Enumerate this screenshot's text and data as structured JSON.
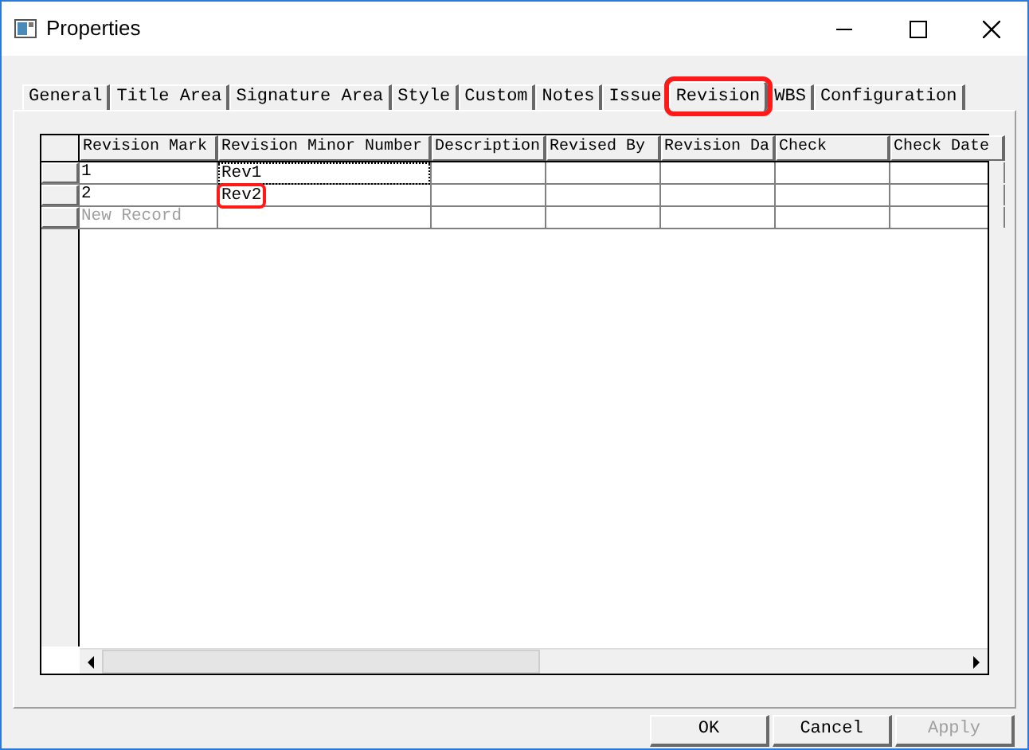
{
  "window": {
    "title": "Properties"
  },
  "tabs": [
    {
      "label": "General",
      "selected": false,
      "highlighted": false
    },
    {
      "label": "Title Area",
      "selected": false,
      "highlighted": false
    },
    {
      "label": "Signature Area",
      "selected": false,
      "highlighted": false
    },
    {
      "label": "Style",
      "selected": false,
      "highlighted": false
    },
    {
      "label": "Custom",
      "selected": false,
      "highlighted": false
    },
    {
      "label": "Notes",
      "selected": false,
      "highlighted": false
    },
    {
      "label": "Issue",
      "selected": false,
      "highlighted": false
    },
    {
      "label": "Revision",
      "selected": true,
      "highlighted": true
    },
    {
      "label": "WBS",
      "selected": false,
      "highlighted": false
    },
    {
      "label": "Configuration",
      "selected": false,
      "highlighted": false
    }
  ],
  "table": {
    "columns": [
      "Revision Mark",
      "Revision Minor Number",
      "Description",
      "Revised By",
      "Revision Da",
      "Check",
      "Check Date"
    ],
    "rows": [
      {
        "revision_mark": "1",
        "revision_minor_number": {
          "text": "Rev1",
          "focused": true,
          "highlighted": false
        }
      },
      {
        "revision_mark": "2",
        "revision_minor_number": {
          "text": "Rev2",
          "focused": false,
          "highlighted": true
        }
      }
    ],
    "new_record": "New Record"
  },
  "buttons": [
    {
      "label": "OK",
      "disabled": false
    },
    {
      "label": "Cancel",
      "disabled": false
    },
    {
      "label": "Apply",
      "disabled": true
    }
  ]
}
